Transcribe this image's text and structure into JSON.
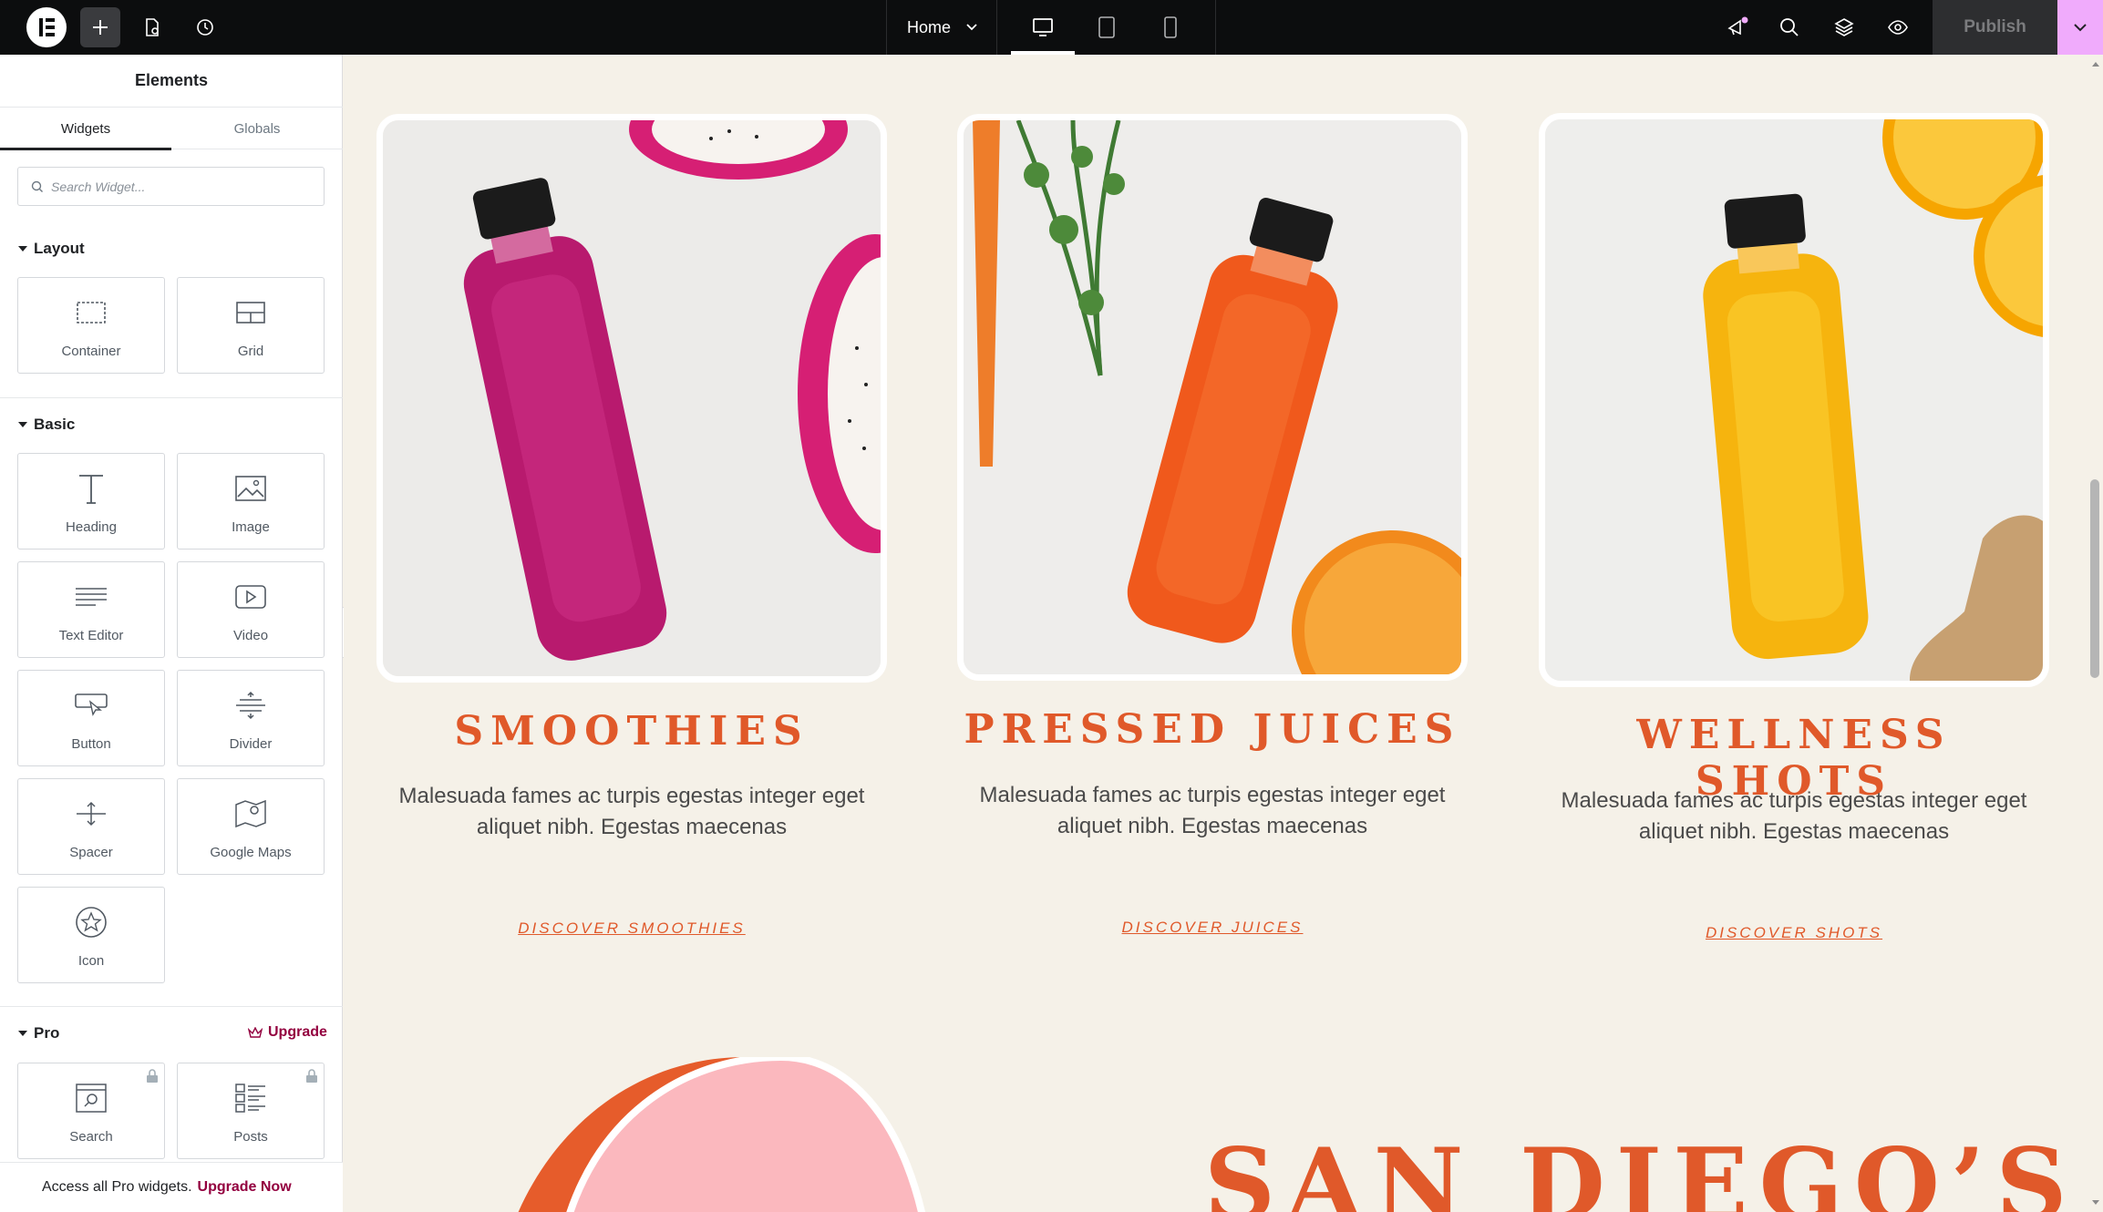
{
  "topbar": {
    "page_selector": "Home",
    "publish_label": "Publish",
    "active_device": "desktop"
  },
  "sidebar": {
    "title": "Elements",
    "tabs": [
      "Widgets",
      "Globals"
    ],
    "search_placeholder": "Search Widget...",
    "sections": {
      "layout": {
        "label": "Layout",
        "widgets": [
          "Container",
          "Grid"
        ]
      },
      "basic": {
        "label": "Basic",
        "widgets": [
          "Heading",
          "Image",
          "Text Editor",
          "Video",
          "Button",
          "Divider",
          "Spacer",
          "Google Maps",
          "Icon"
        ]
      },
      "pro": {
        "label": "Pro",
        "upgrade_label": "Upgrade",
        "widgets": [
          "Search",
          "Posts"
        ]
      }
    },
    "footer_text": "Access all Pro widgets.",
    "footer_link": "Upgrade Now"
  },
  "content": {
    "cards": [
      {
        "title": "SMOOTHIES",
        "description": "Malesuada fames ac turpis egestas integer eget aliquet nibh. Egestas maecenas",
        "link": "DISCOVER SMOOTHIES",
        "bottle_color": "#b81a6e"
      },
      {
        "title": "PRESSED JUICES",
        "description": "Malesuada fames ac turpis egestas integer eget aliquet nibh. Egestas maecenas",
        "link": "DISCOVER JUICES",
        "bottle_color": "#f0591c"
      },
      {
        "title": "WELLNESS SHOTS",
        "description": "Malesuada fames ac turpis egestas integer eget aliquet nibh. Egestas maecenas",
        "link": "DISCOVER SHOTS",
        "bottle_color": "#f6b40e"
      }
    ],
    "bottom_heading": "SAN DIEGO’S"
  },
  "colors": {
    "accent": "#e0592a",
    "brand_pro": "#93003f",
    "publish_dropdown": "#f0abfc",
    "background": "#f5f1e8"
  }
}
